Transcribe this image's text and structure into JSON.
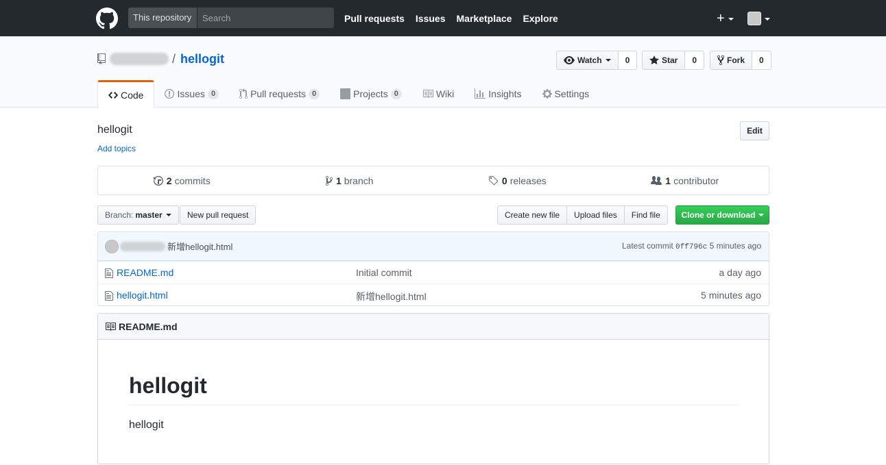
{
  "header": {
    "scope_label": "This repository",
    "search_placeholder": "Search",
    "nav": [
      "Pull requests",
      "Issues",
      "Marketplace",
      "Explore"
    ],
    "new_menu": "+"
  },
  "repo": {
    "separator": "/",
    "name": "hellogit",
    "watch": {
      "label": "Watch",
      "count": "0"
    },
    "star": {
      "label": "Star",
      "count": "0"
    },
    "fork": {
      "label": "Fork",
      "count": "0"
    }
  },
  "tabs": [
    {
      "label": "Code",
      "icon": "code-icon"
    },
    {
      "label": "Issues",
      "count": "0",
      "icon": "issue-icon"
    },
    {
      "label": "Pull requests",
      "count": "0",
      "icon": "pull-request-icon"
    },
    {
      "label": "Projects",
      "count": "0",
      "icon": "project-icon"
    },
    {
      "label": "Wiki",
      "icon": "book-icon"
    },
    {
      "label": "Insights",
      "icon": "graph-icon"
    },
    {
      "label": "Settings",
      "icon": "gear-icon"
    }
  ],
  "description": {
    "text": "hellogit",
    "add_topics": "Add topics",
    "edit": "Edit"
  },
  "summary": {
    "commits": {
      "num": "2",
      "label": "commits"
    },
    "branches": {
      "num": "1",
      "label": "branch"
    },
    "releases": {
      "num": "0",
      "label": "releases"
    },
    "contributors": {
      "num": "1",
      "label": "contributor"
    }
  },
  "file_nav": {
    "branch_label": "Branch:",
    "branch_value": "master",
    "new_pull_request": "New pull request",
    "create_new_file": "Create new file",
    "upload_files": "Upload files",
    "find_file": "Find file",
    "clone": "Clone or download"
  },
  "commit": {
    "message": "新增hellogit.html",
    "latest_label": "Latest commit",
    "sha": "0ff796c",
    "age": "5 minutes ago"
  },
  "files": [
    {
      "name": "README.md",
      "message": "Initial commit",
      "age": "a day ago"
    },
    {
      "name": "hellogit.html",
      "message": "新增hellogit.html",
      "age": "5 minutes ago"
    }
  ],
  "readme": {
    "filename": "README.md",
    "title": "hellogit",
    "body": "hellogit"
  },
  "colors": {
    "header_bg": "#24292e",
    "link": "#0366d6",
    "selected_tab_accent": "#e36209",
    "clone_green": "#28a745"
  }
}
